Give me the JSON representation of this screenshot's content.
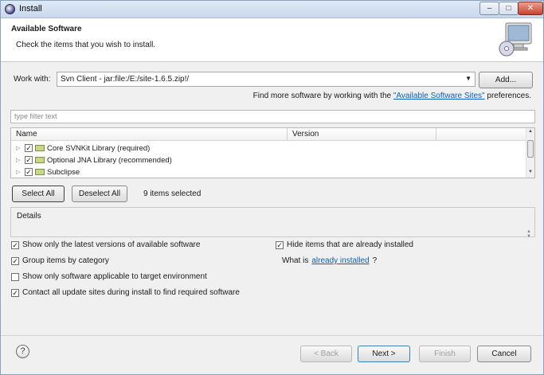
{
  "window": {
    "title": "Install",
    "controls": {
      "minimize": "–",
      "maximize": "□",
      "close": "✕"
    }
  },
  "banner": {
    "title": "Available Software",
    "description": "Check the items that you wish to install."
  },
  "work_with": {
    "label": "Work with:",
    "value": "Svn Client - jar:file:/E:/site-1.6.5.zip!/",
    "add_label": "Add..."
  },
  "find_more": {
    "prefix": "Find more software by working with the ",
    "link": "\"Available Software Sites\"",
    "suffix": " preferences."
  },
  "filter": {
    "placeholder": "type filter text"
  },
  "tree": {
    "columns": [
      "Name",
      "Version"
    ],
    "rows": [
      {
        "label": "Core SVNKit Library (required)",
        "checked": true,
        "icon": "package-icon"
      },
      {
        "label": "Optional JNA Library (recommended)",
        "checked": true,
        "icon": "package-icon"
      },
      {
        "label": "Subclipse",
        "checked": true,
        "icon": "package-icon"
      }
    ]
  },
  "selection": {
    "select_all_label": "Select All",
    "deselect_all_label": "Deselect All",
    "count_text": "9 items selected"
  },
  "details": {
    "label": "Details"
  },
  "options": {
    "latest_versions": {
      "label": "Show only the latest versions of available software",
      "checked": true
    },
    "group_by_category": {
      "label": "Group items by category",
      "checked": true
    },
    "applicable_only": {
      "label": "Show only software applicable to target environment",
      "checked": false
    },
    "contact_sites": {
      "label": "Contact all update sites during install to find required software",
      "checked": true
    },
    "hide_installed": {
      "label": "Hide items that are already installed",
      "checked": true
    },
    "what_is_prefix": "What is ",
    "what_is_link": "already installed",
    "what_is_suffix": "?"
  },
  "footer": {
    "help": "?",
    "back_label": "< Back",
    "next_label": "Next >",
    "finish_label": "Finish",
    "cancel_label": "Cancel"
  }
}
